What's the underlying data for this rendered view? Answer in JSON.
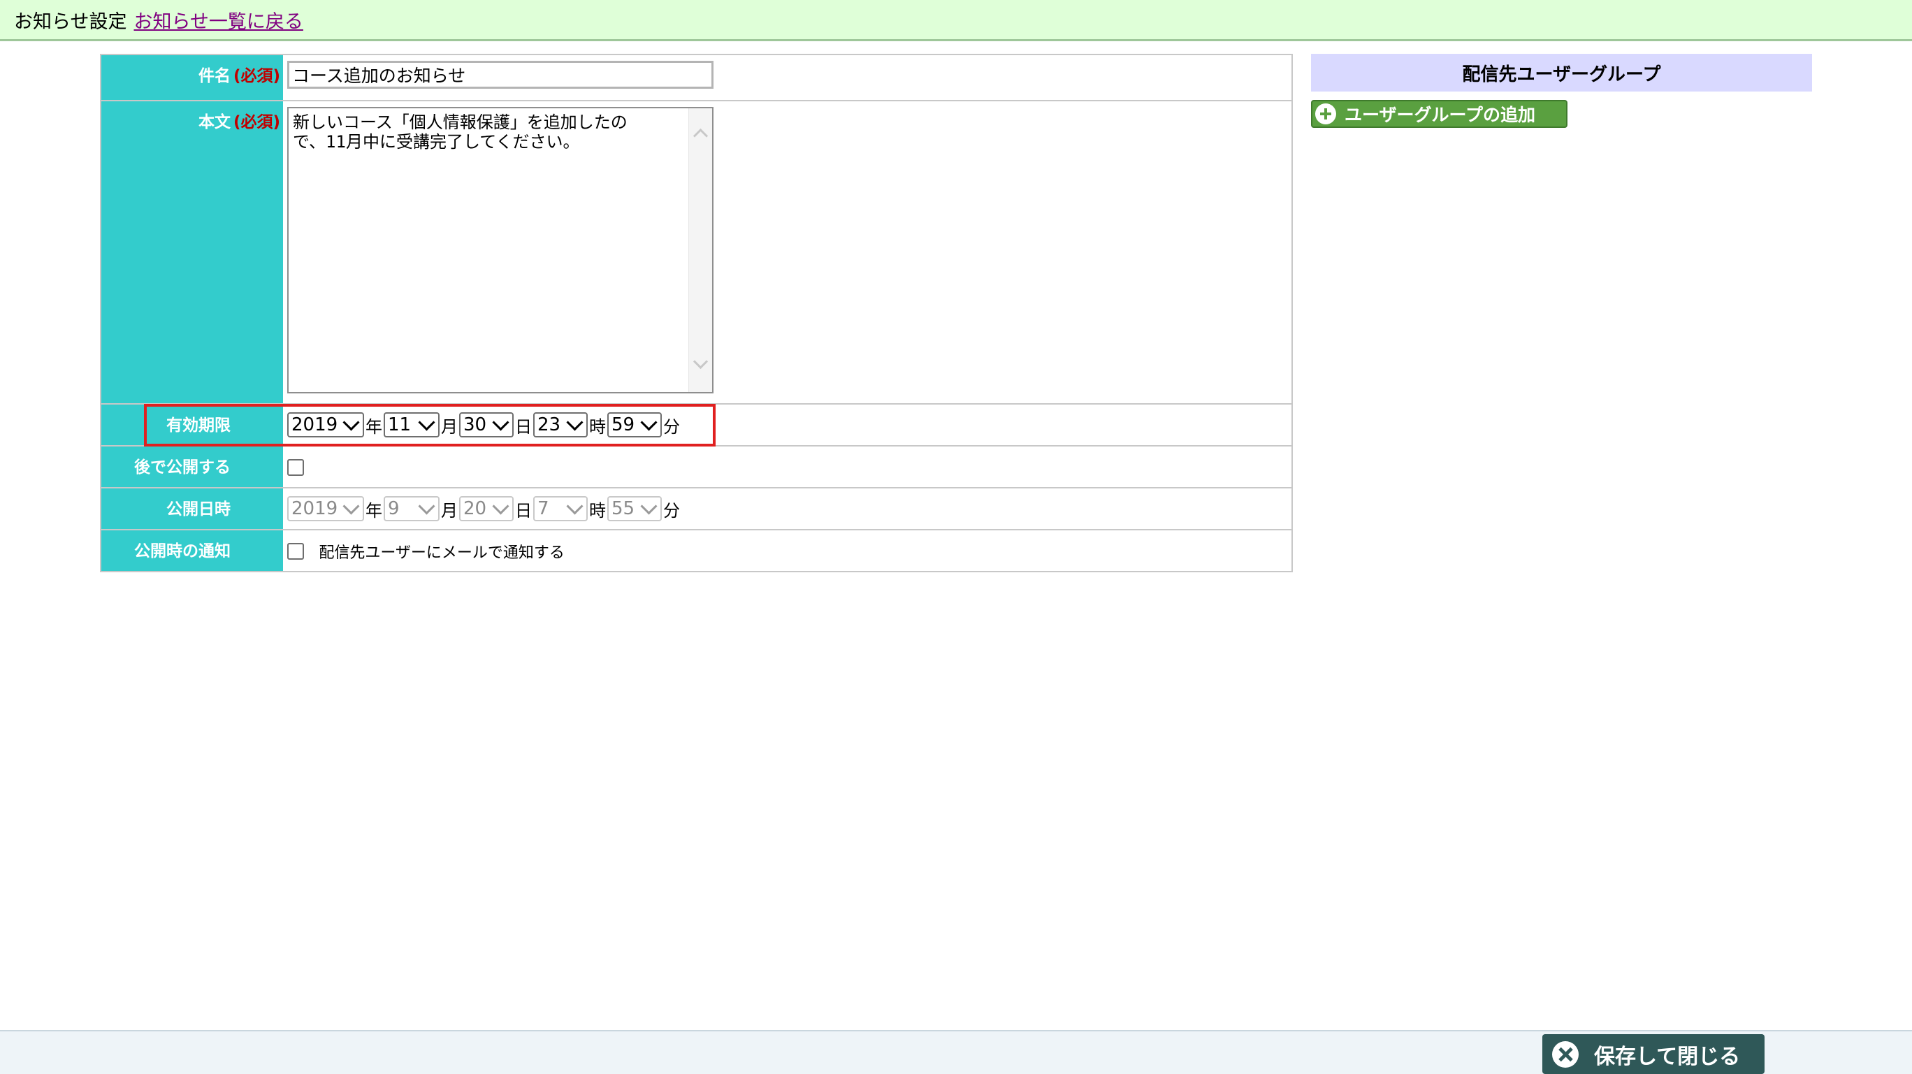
{
  "header": {
    "title": "お知らせ設定",
    "back_link": "お知らせ一覧に戻る"
  },
  "form": {
    "subject": {
      "label": "件名",
      "required": "(必須)",
      "value": "コース追加のお知らせ"
    },
    "body": {
      "label": "本文",
      "required": "(必須)",
      "value": "新しいコース「個人情報保護」を追加したの\nで、11月中に受講完了してください。"
    },
    "expiry": {
      "label": "有効期限",
      "year": "2019",
      "month": "11",
      "day": "30",
      "hour": "23",
      "minute": "59"
    },
    "publish_later": {
      "label": "後で公開する",
      "checked": false
    },
    "publish_date": {
      "label": "公開日時",
      "year": "2019",
      "month": "9",
      "day": "20",
      "hour": "7",
      "minute": "55"
    },
    "notify": {
      "label": "公開時の通知",
      "checkbox_text": "配信先ユーザーにメールで通知する",
      "checked": false
    },
    "units": {
      "year": "年",
      "month": "月",
      "day": "日",
      "hour": "時",
      "minute": "分"
    }
  },
  "right_panel": {
    "title": "配信先ユーザーグループ",
    "add_button": "ユーザーグループの追加"
  },
  "footer": {
    "save_close": "保存して閉じる"
  },
  "colors": {
    "label_bg": "#33cccc",
    "header_bg": "#dfffd8",
    "panel_header_bg": "#d9d9ff",
    "add_button_bg": "#5aa040",
    "save_button_bg": "#2f5858",
    "highlight": "#e02020"
  }
}
